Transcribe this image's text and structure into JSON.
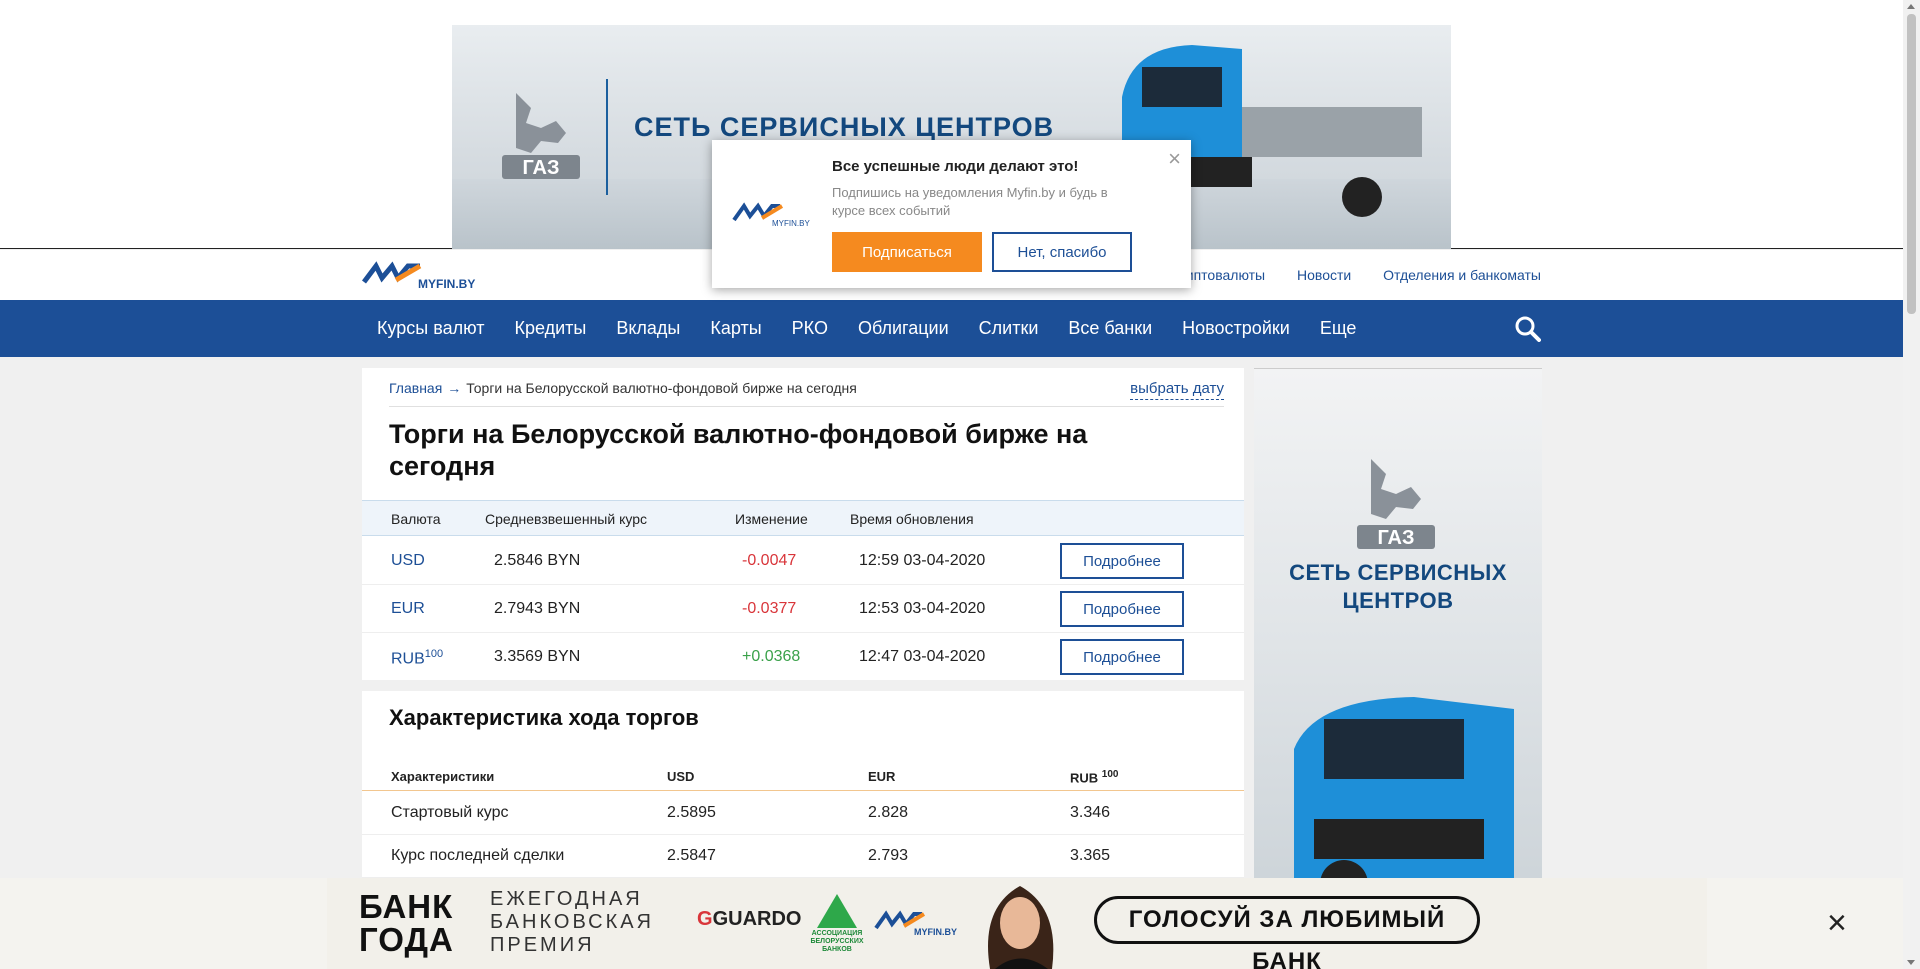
{
  "top_ad": {
    "title": "СЕТЬ СЕРВИСНЫХ ЦЕНТРОВ",
    "brand": "ГАЗ"
  },
  "popup": {
    "heading": "Все успешные люди делают это!",
    "text": "Подпишись на уведомления Myfin.by и будь в курсе всех событий",
    "subscribe_label": "Подписаться",
    "decline_label": "Нет, спасибо",
    "close_icon": "×"
  },
  "header": {
    "logo_text": "MYFIN.BY",
    "links": [
      "Криптовалюты",
      "Новости",
      "Отделения и банкоматы"
    ]
  },
  "nav": {
    "items": [
      "Курсы валют",
      "Кредиты",
      "Вклады",
      "Карты",
      "РКО",
      "Облигации",
      "Слитки",
      "Все банки",
      "Новостройки",
      "Еще"
    ]
  },
  "breadcrumb": {
    "home": "Главная",
    "arrow": "→",
    "current": "Торги на Белорусской валютно-фондовой бирже на сегодня"
  },
  "pick_date_label": "выбрать дату",
  "page_title": "Торги на Белорусской валютно-фондовой бирже на сегодня",
  "rates_table": {
    "headers": [
      "Валюта",
      "Средневзвешенный курс",
      "Изменение",
      "Время обновления"
    ],
    "rows": [
      {
        "currency": "USD",
        "sup": "",
        "rate": "2.5846 BYN",
        "change": "-0.0047",
        "time": "12:59 03-04-2020",
        "button": "Подробнее"
      },
      {
        "currency": "EUR",
        "sup": "",
        "rate": "2.7943 BYN",
        "change": "-0.0377",
        "time": "12:53 03-04-2020",
        "button": "Подробнее"
      },
      {
        "currency": "RUB",
        "sup": "100",
        "rate": "3.3569 BYN",
        "change": "+0.0368",
        "time": "12:47 03-04-2020",
        "button": "Подробнее"
      }
    ]
  },
  "characteristics": {
    "title": "Характеристика хода торгов",
    "headers": [
      "Характеристики",
      "USD",
      "EUR",
      "RUB"
    ],
    "rub_sup": "100",
    "rows": [
      {
        "label": "Стартовый курс",
        "usd": "2.5895",
        "eur": "2.828",
        "rub": "3.346"
      },
      {
        "label": "Курс последней сделки",
        "usd": "2.5847",
        "eur": "2.793",
        "rub": "3.365"
      }
    ]
  },
  "side_ad": {
    "title_line1": "СЕТЬ СЕРВИСНЫХ",
    "title_line2": "ЦЕНТРОВ",
    "brand": "ГАЗ"
  },
  "bottom_ad": {
    "bank_line1": "БАНК",
    "bank_line2": "ГОДА",
    "premium_line1": "ЕЖЕГОДНАЯ",
    "premium_line2": "БАНКОВСКАЯ",
    "premium_line3": "ПРЕМИЯ",
    "guardo": "GUARDO",
    "assoc_line1": "АССОЦИАЦИЯ",
    "assoc_line2": "БЕЛОРУССКИХ",
    "assoc_line3": "БАНКОВ",
    "vote_label": "ГОЛОСУЙ ЗА ЛЮБИМЫЙ БАНК",
    "close_icon": "×"
  },
  "colors": {
    "brand_blue": "#1c4f97",
    "accent_orange": "#f58a1f",
    "negative": "#d9353a",
    "positive": "#3aa14a"
  }
}
